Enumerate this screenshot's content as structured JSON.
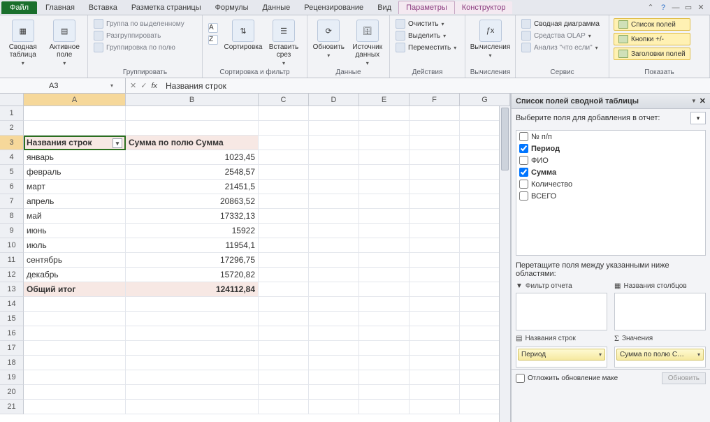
{
  "tabs": {
    "file": "Файл",
    "items": [
      "Главная",
      "Вставка",
      "Разметка страницы",
      "Формулы",
      "Данные",
      "Рецензирование",
      "Вид"
    ],
    "context": [
      "Параметры",
      "Конструктор"
    ],
    "context_active_index": 0
  },
  "ribbon": {
    "groups": {
      "g0_btns": {
        "pivot": "Сводная таблица",
        "field": "Активное поле"
      },
      "group0": "",
      "group1": "Группировать",
      "group1_items": [
        "Группа по выделенному",
        "Разгруппировать",
        "Группировка по полю"
      ],
      "group2": "Сортировка и фильтр",
      "group2_sort": "Сортировка",
      "group2_slicer": "Вставить срез",
      "group3": "Данные",
      "group3_refresh": "Обновить",
      "group3_source": "Источник данных",
      "group4": "Действия",
      "group4_items": [
        "Очистить",
        "Выделить",
        "Переместить"
      ],
      "group5": "Вычисления",
      "group5_btn": "Вычисления",
      "group6": "Сервис",
      "group6_items": [
        "Сводная диаграмма",
        "Средства OLAP",
        "Анализ \"что если\""
      ],
      "group7": "Показать",
      "group7_items": [
        "Список полей",
        "Кнопки +/-",
        "Заголовки полей"
      ]
    }
  },
  "namebox": "A3",
  "formula": "Названия строк",
  "grid": {
    "columns": [
      "A",
      "B",
      "C",
      "D",
      "E",
      "F",
      "G"
    ],
    "header_row": 3,
    "headers": {
      "A": "Названия строк",
      "B": "Сумма по полю Сумма"
    },
    "data": [
      {
        "r": 4,
        "A": "январь",
        "B": "1023,45"
      },
      {
        "r": 5,
        "A": "февраль",
        "B": "2548,57"
      },
      {
        "r": 6,
        "A": "март",
        "B": "21451,5"
      },
      {
        "r": 7,
        "A": "апрель",
        "B": "20863,52"
      },
      {
        "r": 8,
        "A": "май",
        "B": "17332,13"
      },
      {
        "r": 9,
        "A": "июнь",
        "B": "15922"
      },
      {
        "r": 10,
        "A": "июль",
        "B": "11954,1"
      },
      {
        "r": 11,
        "A": "сентябрь",
        "B": "17296,75"
      },
      {
        "r": 12,
        "A": "декабрь",
        "B": "15720,82"
      }
    ],
    "total": {
      "r": 13,
      "A": "Общий итог",
      "B": "124112,84"
    },
    "row_count": 21,
    "active_cell": "A3"
  },
  "panel": {
    "title": "Список полей сводной таблицы",
    "choose_label": "Выберите поля для добавления в отчет:",
    "fields": [
      {
        "name": "№ п/п",
        "checked": false
      },
      {
        "name": "Период",
        "checked": true
      },
      {
        "name": "ФИО",
        "checked": false
      },
      {
        "name": "Сумма",
        "checked": true
      },
      {
        "name": "Количество",
        "checked": false
      },
      {
        "name": "ВСЕГО",
        "checked": false
      }
    ],
    "drag_label": "Перетащите поля между указанными ниже областями:",
    "area_filter": "Фильтр отчета",
    "area_cols": "Названия столбцов",
    "area_rows": "Названия строк",
    "area_vals": "Значения",
    "row_item": "Период",
    "val_item": "Сумма по полю С…",
    "defer": "Отложить обновление маке",
    "update": "Обновить"
  }
}
